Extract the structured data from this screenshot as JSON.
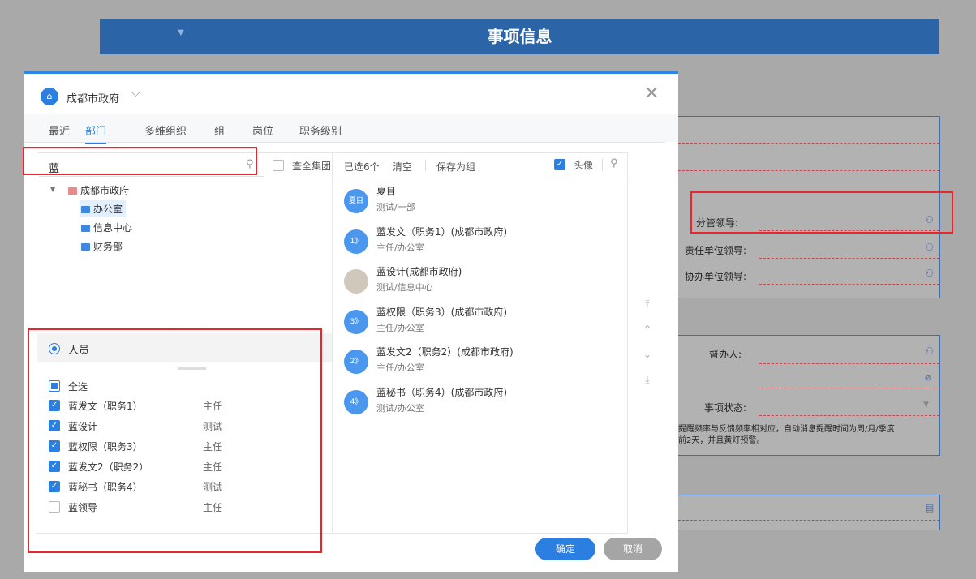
{
  "page": {
    "banner_title": "事项信息",
    "fields": {
      "leader_label": "分管领导:",
      "resp_leader_label": "责任单位领导:",
      "assist_leader_label": "协办单位领导:",
      "supervisor_label": "督办人:",
      "status_label": "事项状态:",
      "note_line1": "提醒频率与反馈频率相对应，自动消息提醒时间为周/月/季度",
      "note_line2": "前2天，并且黄灯预警。"
    }
  },
  "dialog": {
    "org_icon": "⌂",
    "org_name": "成都市政府",
    "tabs": [
      "最近",
      "部门",
      "多维组织",
      "组",
      "岗位",
      "职务级别"
    ],
    "search_value": "蓝",
    "search_group_label": "查全集团",
    "tree": {
      "root": "成都市政府",
      "children": [
        "办公室",
        "信息中心",
        "财务部"
      ]
    },
    "people_type_label": "人员",
    "select_all_label": "全选",
    "people": [
      {
        "name": "蓝发文（职务1）",
        "position": "主任",
        "checked": true
      },
      {
        "name": "蓝设计",
        "position": "测试",
        "checked": true
      },
      {
        "name": "蓝权限（职务3）",
        "position": "主任",
        "checked": true
      },
      {
        "name": "蓝发文2（职务2）",
        "position": "主任",
        "checked": true
      },
      {
        "name": "蓝秘书（职务4）",
        "position": "测试",
        "checked": true
      },
      {
        "name": "蓝领导",
        "position": "主任",
        "checked": false
      }
    ],
    "selected_count_label": "已选6个",
    "clear_label": "清空",
    "save_group_label": "保存为组",
    "avatar_toggle_label": "头像",
    "selected": [
      {
        "avatar": "夏目",
        "name": "夏目",
        "dept": "测试/一部"
      },
      {
        "avatar": "1》",
        "name": "蓝发文（职务1）(成都市政府)",
        "dept": "主任/办公室"
      },
      {
        "avatar": "",
        "name": "蓝设计(成都市政府)",
        "dept": "测试/信息中心"
      },
      {
        "avatar": "3》",
        "name": "蓝权限（职务3）(成都市政府)",
        "dept": "主任/办公室"
      },
      {
        "avatar": "2》",
        "name": "蓝发文2（职务2）(成都市政府)",
        "dept": "主任/办公室"
      },
      {
        "avatar": "4》",
        "name": "蓝秘书（职务4）(成都市政府)",
        "dept": "测试/办公室"
      }
    ],
    "ok_label": "确定",
    "cancel_label": "取消"
  }
}
